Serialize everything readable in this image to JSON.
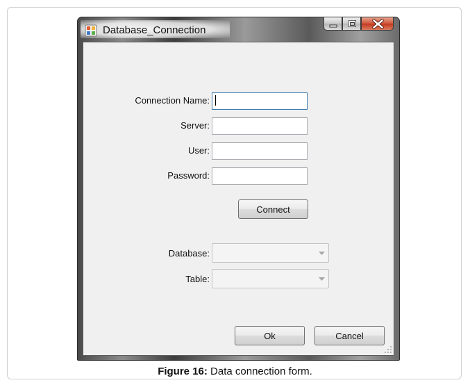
{
  "window": {
    "title": "Database_Connection",
    "controls": [
      "minimize-icon",
      "maximize-icon",
      "close-icon"
    ]
  },
  "form": {
    "connection_name": {
      "label": "Connection Name:",
      "value": "",
      "focused": true
    },
    "server": {
      "label": "Server:",
      "value": ""
    },
    "user": {
      "label": "User:",
      "value": ""
    },
    "password": {
      "label": "Password:",
      "value": ""
    },
    "connect_button": "Connect",
    "database": {
      "label": "Database:",
      "selected": "",
      "enabled": false
    },
    "table": {
      "label": "Table:",
      "selected": "",
      "enabled": false
    },
    "ok_button": "Ok",
    "cancel_button": "Cancel"
  },
  "figure": {
    "label": "Figure 16:",
    "caption": " Data connection form."
  },
  "colors": {
    "close_button": "#c8462c",
    "client_background": "#f0f0f0",
    "focus_border": "#3d7bad"
  }
}
